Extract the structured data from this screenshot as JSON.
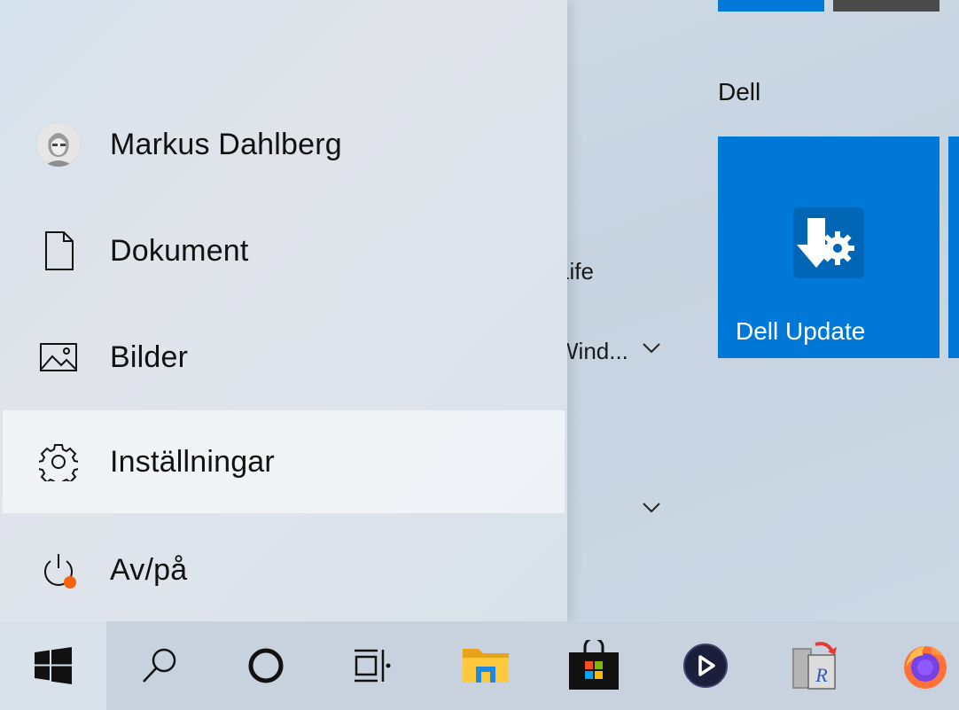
{
  "start_menu": {
    "items": [
      {
        "label": "Markus Dahlberg",
        "icon": "user-avatar"
      },
      {
        "label": "Dokument",
        "icon": "document-icon"
      },
      {
        "label": "Bilder",
        "icon": "pictures-icon"
      },
      {
        "label": "Inställningar",
        "icon": "gear-icon"
      },
      {
        "label": "Av/på",
        "icon": "power-icon"
      }
    ]
  },
  "app_list": {
    "partial_1": "Life",
    "partial_2": "Wind..."
  },
  "tiles": {
    "group_label": "Dell",
    "dell_update_label": "Dell Update"
  },
  "colors": {
    "tile_blue": "#0078d7",
    "power_badge": "#f7630c"
  },
  "taskbar": {
    "buttons": [
      "windows-start-icon",
      "search-icon",
      "cortana-icon",
      "task-view-icon",
      "file-explorer-icon",
      "microsoft-store-icon",
      "media-player-icon",
      "recycle-app-icon",
      "firefox-icon"
    ]
  }
}
